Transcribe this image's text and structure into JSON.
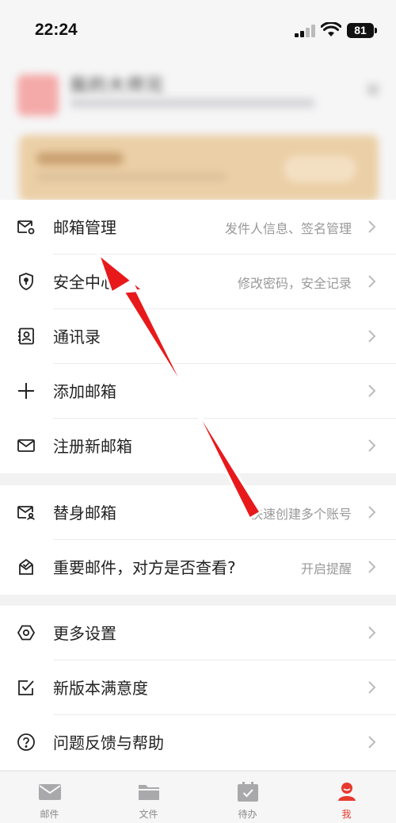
{
  "status_bar": {
    "time": "22:24",
    "battery": "81"
  },
  "profile": {
    "name": "我的大师兄"
  },
  "menu_section_1": [
    {
      "label": "邮箱管理",
      "hint": "发件人信息、签名管理",
      "icon": "mail-settings-icon"
    },
    {
      "label": "安全中心",
      "hint": "修改密码，安全记录",
      "icon": "shield-icon"
    },
    {
      "label": "通讯录",
      "hint": "",
      "icon": "contacts-icon"
    },
    {
      "label": "添加邮箱",
      "hint": "",
      "icon": "plus-icon"
    },
    {
      "label": "注册新邮箱",
      "hint": "",
      "icon": "mail-icon"
    }
  ],
  "menu_section_2": [
    {
      "label": "替身邮箱",
      "hint": "快速创建多个账号",
      "icon": "alias-mail-icon"
    },
    {
      "label": "重要邮件，对方是否查看?",
      "hint": "开启提醒",
      "icon": "read-receipt-icon"
    }
  ],
  "menu_section_3": [
    {
      "label": "更多设置",
      "hint": "",
      "icon": "gear-icon"
    },
    {
      "label": "新版本满意度",
      "hint": "",
      "icon": "checkbox-icon"
    },
    {
      "label": "问题反馈与帮助",
      "hint": "",
      "icon": "help-icon"
    }
  ],
  "tabbar": [
    {
      "label": "邮件",
      "icon": "mail-tab-icon",
      "active": false
    },
    {
      "label": "文件",
      "icon": "folder-tab-icon",
      "active": false
    },
    {
      "label": "待办",
      "icon": "calendar-tab-icon",
      "active": false
    },
    {
      "label": "我",
      "icon": "me-tab-icon",
      "active": true
    }
  ],
  "colors": {
    "accent": "#e63a2e",
    "annotation_arrow": "#e8191b",
    "vip_card": "#ebcfa6"
  }
}
